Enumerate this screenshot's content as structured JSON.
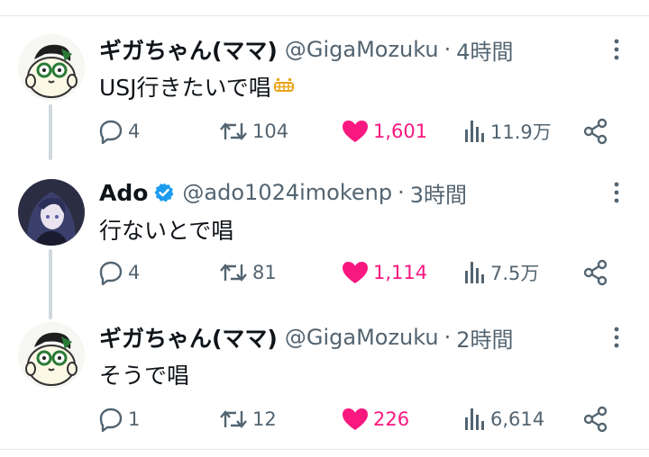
{
  "tweets": [
    {
      "name": "ギガちゃん(ママ)",
      "handle": "@GigaMozuku",
      "separator": "·",
      "time": "4時間",
      "text": "USJ行きたいで唱",
      "emoji": "grimacing-face-emoji",
      "replies": "4",
      "retweets": "104",
      "likes": "1,601",
      "views": "11.9万"
    },
    {
      "name": "Ado",
      "handle": "@ado1024imokenp",
      "separator": "·",
      "time": "3時間",
      "text": "行ないとで唱",
      "verified": true,
      "replies": "4",
      "retweets": "81",
      "likes": "1,114",
      "views": "7.5万"
    },
    {
      "name": "ギガちゃん(ママ)",
      "handle": "@GigaMozuku",
      "separator": "·",
      "time": "2時間",
      "text": "そうで唱",
      "replies": "1",
      "retweets": "12",
      "likes": "226",
      "views": "6,614"
    }
  ],
  "colors": {
    "like": "#f91880",
    "verified": "#1d9bf0",
    "secondary_text": "#536471",
    "thread_line": "#cfd9de"
  },
  "icons": [
    "reply-icon",
    "retweet-icon",
    "heart-icon",
    "views-icon",
    "share-icon",
    "more-icon",
    "verified-badge-icon"
  ]
}
